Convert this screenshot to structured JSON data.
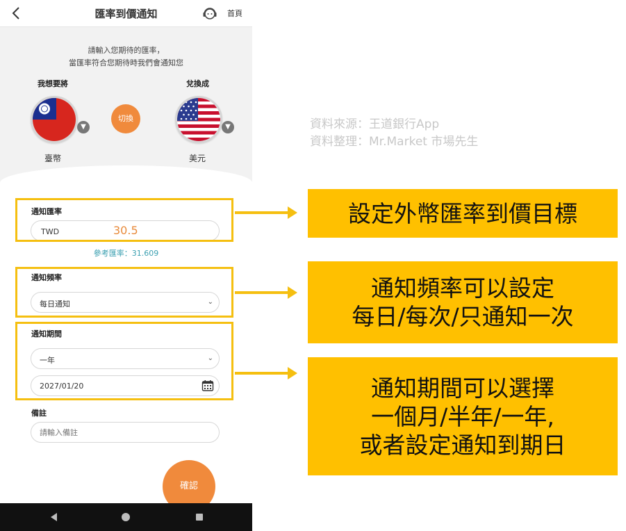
{
  "header": {
    "back_icon": "chevron-left-icon",
    "title": "匯率到價通知",
    "customer_service_icon": "headset-icon",
    "home_label": "首頁"
  },
  "intro": {
    "line1": "請輸入您期待的匯率，",
    "line2": "當匯率符合您期待時我們會通知您"
  },
  "exchange": {
    "from_label": "我想要將",
    "from_currency": "臺幣",
    "to_label": "兌換成",
    "to_currency": "美元",
    "switch_label": "切換"
  },
  "form": {
    "rate": {
      "title": "通知匯率",
      "prefix": "TWD",
      "value": "30.5",
      "reference": "參考匯率：31.609"
    },
    "frequency": {
      "title": "通知頻率",
      "selected": "每日通知"
    },
    "period": {
      "title": "通知期間",
      "selected": "一年",
      "date": "2027/01/20"
    },
    "note": {
      "title": "備註",
      "placeholder": "請輸入備註"
    },
    "confirm_label": "確認"
  },
  "annotations": {
    "source_line1": "資料來源：王道銀行App",
    "source_line2": "資料整理：Mr.Market 市場先生",
    "callout1": [
      "設定外幣匯率到價目標"
    ],
    "callout2": [
      "通知頻率可以設定",
      "每日/每次/只通知一次"
    ],
    "callout3": [
      "通知期間可以選擇",
      "一個月/半年/一年,",
      "或者設定通知到期日"
    ]
  },
  "colors": {
    "accent_orange": "#f08a3c",
    "highlight_yellow": "#ffc000",
    "reference_teal": "#3a9fb0"
  }
}
